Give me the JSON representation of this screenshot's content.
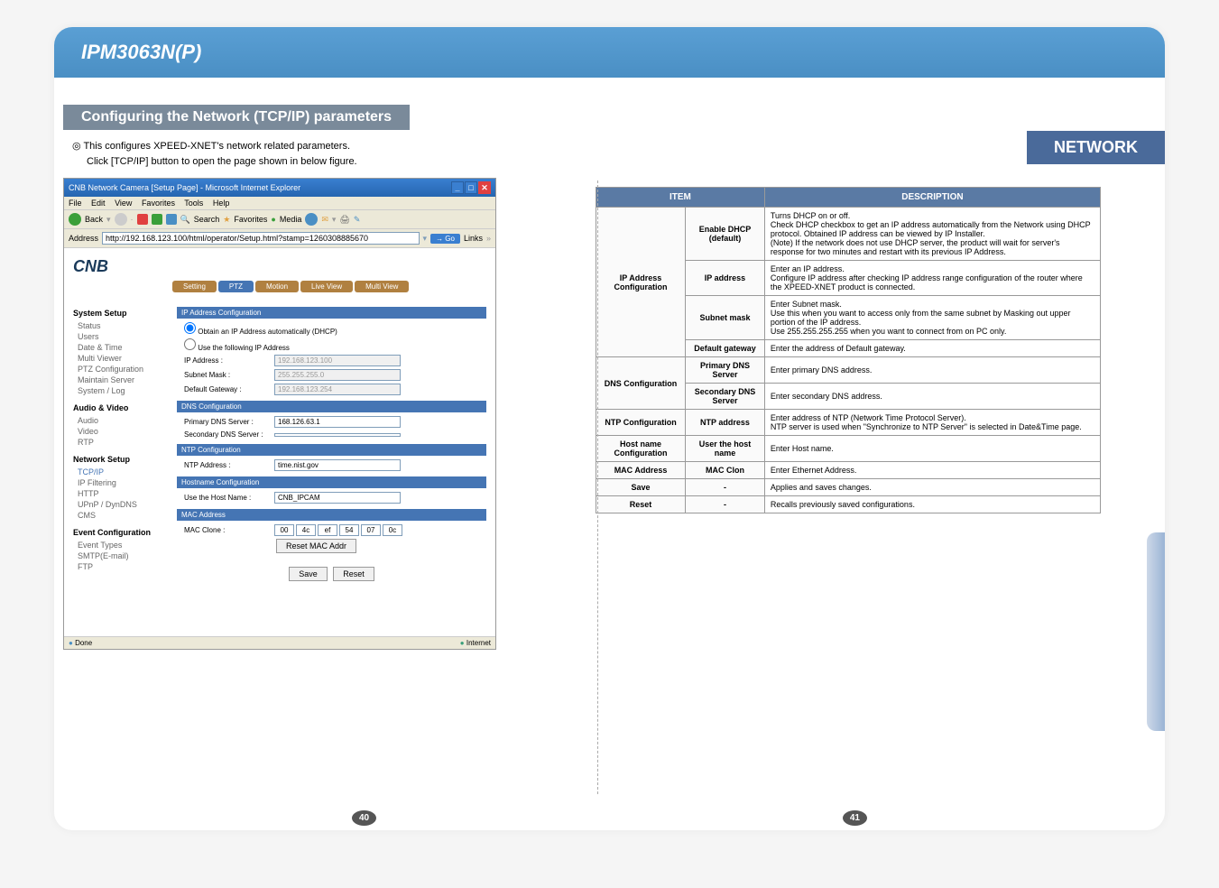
{
  "header": {
    "title": "IPM3063N(P)"
  },
  "network_badge": "NETWORK",
  "section_title": "Configuring the Network (TCP/IP) parameters",
  "intro": {
    "line1": "◎ This configures XPEED-XNET's network related parameters.",
    "line2": "Click [TCP/IP] button to open the page shown in below figure."
  },
  "browser": {
    "title": "CNB Network Camera [Setup Page] - Microsoft Internet Explorer",
    "menus": [
      "File",
      "Edit",
      "View",
      "Favorites",
      "Tools",
      "Help"
    ],
    "toolbar": {
      "back": "Back",
      "search": "Search",
      "favorites": "Favorites",
      "media": "Media"
    },
    "address_label": "Address",
    "address_value": "http://192.168.123.100/html/operator/Setup.html?stamp=1260308885670",
    "go": "Go",
    "links": "Links",
    "logo": "CNB",
    "tabs": {
      "setting": "Setting",
      "ptz": "PTZ",
      "motion": "Motion",
      "liveview": "Live View",
      "multiview": "Multi View"
    },
    "sidebar": {
      "system_setup": "System Setup",
      "system_items": [
        "Status",
        "Users",
        "Date & Time",
        "Multi Viewer",
        "PTZ Configuration",
        "Maintain Server",
        "System / Log"
      ],
      "audio_video": "Audio & Video",
      "av_items": [
        "Audio",
        "Video",
        "RTP"
      ],
      "network_setup": "Network Setup",
      "network_items": [
        "TCP/IP",
        "IP Filtering",
        "HTTP",
        "UPnP / DynDNS",
        "CMS"
      ],
      "event_config": "Event Configuration",
      "event_items": [
        "Event Types",
        "SMTP(E-mail)",
        "FTP"
      ]
    },
    "config": {
      "ip_section": "IP Address Configuration",
      "radio_dhcp": "Obtain an IP Address automatically (DHCP)",
      "radio_static": "Use the following IP Address",
      "ip_label": "IP Address :",
      "ip_value": "192.168.123.100",
      "subnet_label": "Subnet Mask :",
      "subnet_value": "255.255.255.0",
      "gateway_label": "Default Gateway :",
      "gateway_value": "192.168.123.254",
      "dns_section": "DNS Configuration",
      "pdns_label": "Primary DNS Server :",
      "pdns_value": "168.126.63.1",
      "sdns_label": "Secondary DNS Server :",
      "sdns_value": "",
      "ntp_section": "NTP Configuration",
      "ntp_label": "NTP Address :",
      "ntp_value": "time.nist.gov",
      "host_section": "Hostname Configuration",
      "host_label": "Use the Host Name :",
      "host_value": "CNB_IPCAM",
      "mac_section": "MAC Address",
      "mac_label": "MAC Clone :",
      "mac_values": [
        "00",
        "4c",
        "ef",
        "54",
        "07",
        "0c"
      ],
      "reset_mac": "Reset MAC Addr",
      "save_btn": "Save",
      "reset_btn": "Reset"
    },
    "status": {
      "done": "Done",
      "internet": "Internet"
    }
  },
  "table": {
    "header_item": "ITEM",
    "header_desc": "DESCRIPTION",
    "rows": [
      {
        "cat": "IP Address Configuration",
        "sub": "Enable DHCP (default)",
        "desc": "Turns DHCP on or off.\nCheck DHCP checkbox to get an IP address automatically from the Network using DHCP protocol. Obtained IP address can be viewed by IP Installer.\n(Note) If the network does not use DHCP server, the product will wait for server's response for two minutes and restart with its previous IP Address."
      },
      {
        "sub": "IP address",
        "desc": "Enter an IP address.\nConfigure IP address after checking IP address range configuration of the router where the XPEED-XNET product is connected."
      },
      {
        "sub": "Subnet mask",
        "desc": "Enter Subnet mask.\nUse this when you want to access only from the same subnet by Masking out upper portion of the IP address.\nUse 255.255.255.255 when you want to connect from on PC only."
      },
      {
        "sub": "Default gateway",
        "desc": "Enter the address of Default gateway."
      },
      {
        "cat": "DNS Configuration",
        "sub": "Primary DNS Server",
        "desc": "Enter primary DNS address."
      },
      {
        "sub": "Secondary DNS Server",
        "desc": "Enter secondary DNS address."
      },
      {
        "cat": "NTP Configuration",
        "sub": "NTP address",
        "desc": "Enter address of NTP (Network Time Protocol Server).\nNTP server is used when \"Synchronize to NTP Server\" is selected in Date&Time page."
      },
      {
        "cat": "Host name Configuration",
        "sub": "User the host name",
        "desc": "Enter Host name."
      },
      {
        "cat": "MAC Address",
        "sub": "MAC Clon",
        "desc": "Enter Ethernet Address."
      },
      {
        "cat": "Save",
        "sub": "-",
        "desc": "Applies and saves changes."
      },
      {
        "cat": "Reset",
        "sub": "-",
        "desc": "Recalls previously saved configurations."
      }
    ]
  },
  "page_left": "40",
  "page_right": "41"
}
